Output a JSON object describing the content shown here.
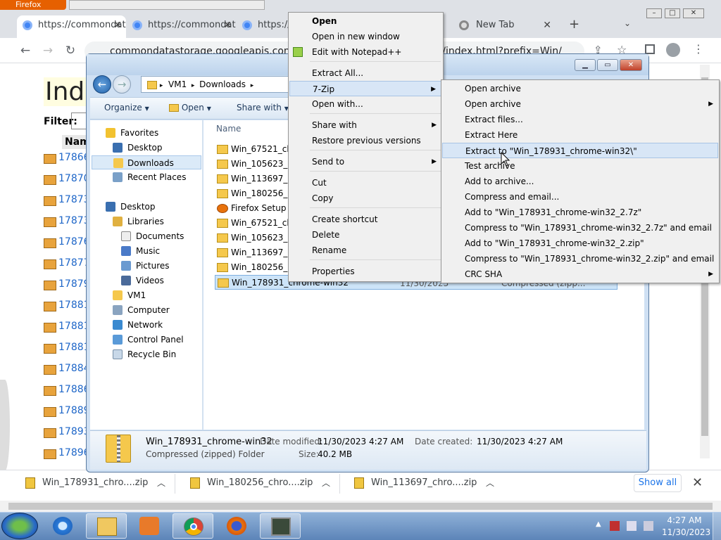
{
  "browser": {
    "firefox_button": "Firefox",
    "tabs": [
      {
        "title": "https://commondatastorage.googleapis.com"
      },
      {
        "title": "https://commondatastorage.googleapis.com"
      },
      {
        "title": "https://commondatastorage.googleapis.com"
      },
      {
        "title": "New Tab"
      }
    ],
    "url": "commondatastorage.googleapis.com/chromium-browser-snapshots/index.html?prefix=Win/",
    "new_tab_symbol": "+",
    "page": {
      "heading": "Index",
      "filter_label": "Filter:",
      "name_header": "Name",
      "dir_links": [
        "17866",
        "17870",
        "17873",
        "17873",
        "17876",
        "17877",
        "17879",
        "17881",
        "17881",
        "17881",
        "17884",
        "17886",
        "17889",
        "17893",
        "17896"
      ]
    },
    "downloads": [
      {
        "label": "Win_178931_chro....zip"
      },
      {
        "label": "Win_180256_chro....zip"
      },
      {
        "label": "Win_113697_chro....zip"
      }
    ],
    "show_all": "Show all"
  },
  "explorer": {
    "breadcrumb": [
      "VM1",
      "Downloads"
    ],
    "toolbar": {
      "organize": "Organize",
      "open": "Open",
      "share_with": "Share with"
    },
    "nav": {
      "favorites": "Favorites",
      "desktop": "Desktop",
      "downloads": "Downloads",
      "recent_places": "Recent Places",
      "desktop_root": "Desktop",
      "libraries": "Libraries",
      "documents": "Documents",
      "music": "Music",
      "pictures": "Pictures",
      "videos": "Videos",
      "vm1": "VM1",
      "computer": "Computer",
      "network": "Network",
      "control_panel": "Control Panel",
      "recycle_bin": "Recycle Bin"
    },
    "column_name": "Name",
    "files": [
      {
        "name": "Win_67521_chrome-win32"
      },
      {
        "name": "Win_105623_chrome-win32"
      },
      {
        "name": "Win_113697_chrome-win32"
      },
      {
        "name": "Win_180256_chrome-win32"
      },
      {
        "name": "Firefox Setup 27"
      },
      {
        "name": "Win_67521_chrome-win32"
      },
      {
        "name": "Win_105623_chrome-win32"
      },
      {
        "name": "Win_113697_chrome-win32"
      },
      {
        "name": "Win_180256_chrome-win32"
      },
      {
        "name": "Win_178931_chrome-win32"
      }
    ],
    "selected_date_fragment": "11/30/2023",
    "selected_type_fragment": "Compressed (zipp...",
    "details": {
      "name": "Win_178931_chrome-win32",
      "type": "Compressed (zipped) Folder",
      "date_modified_label": "Date modified:",
      "date_modified": "11/30/2023 4:27 AM",
      "size_label": "Size:",
      "size": "40.2 MB",
      "date_created_label": "Date created:",
      "date_created": "11/30/2023 4:27 AM"
    }
  },
  "context_menu": {
    "open": "Open",
    "open_new_window": "Open in new window",
    "edit_notepad": "Edit with Notepad++",
    "extract_all": "Extract All...",
    "seven_zip": "7-Zip",
    "open_with": "Open with...",
    "share_with": "Share with",
    "restore_previous": "Restore previous versions",
    "send_to": "Send to",
    "cut": "Cut",
    "copy": "Copy",
    "create_shortcut": "Create shortcut",
    "delete": "Delete",
    "rename": "Rename",
    "properties": "Properties"
  },
  "seven_zip_menu": {
    "open_archive": "Open archive",
    "open_archive_sub": "Open archive",
    "extract_files": "Extract files...",
    "extract_here": "Extract Here",
    "extract_to": "Extract to \"Win_178931_chrome-win32\\\"",
    "test_archive": "Test archive",
    "add_to_archive": "Add to archive...",
    "compress_email": "Compress and email...",
    "add_7z": "Add to \"Win_178931_chrome-win32_2.7z\"",
    "compress_7z_email": "Compress to \"Win_178931_chrome-win32_2.7z\" and email",
    "add_zip": "Add to \"Win_178931_chrome-win32_2.zip\"",
    "compress_zip_email": "Compress to \"Win_178931_chrome-win32_2.zip\" and email",
    "crc_sha": "CRC SHA"
  },
  "taskbar": {
    "time": "4:27 AM",
    "date": "11/30/2023"
  },
  "icons": {
    "start": "windows-start-icon",
    "ie": "internet-explorer-icon",
    "explorer": "file-explorer-icon",
    "media": "media-player-icon",
    "chrome": "chrome-icon",
    "firefox": "firefox-icon",
    "terminal": "monitor-icon"
  }
}
